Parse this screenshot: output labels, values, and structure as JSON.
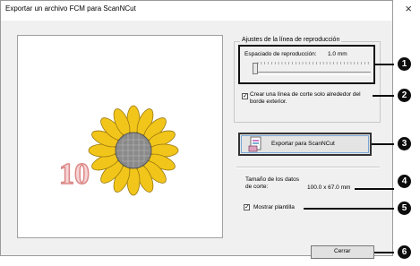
{
  "window": {
    "title": "Exportar un archivo FCM para ScanNCut",
    "close_glyph": "×"
  },
  "preview": {
    "number_text": "10",
    "flower_color": "#f2c51a",
    "number_color": "#e4a0a0"
  },
  "playback": {
    "group_label": "Ajustes de la línea de reproducción",
    "spacing_label": "Espaciado de reproducción:",
    "spacing_value": "1.0 mm",
    "slider_level": 0.0
  },
  "cut_line": {
    "checked": true,
    "label": "Crear una línea de corte solo alrededor del borde exterior."
  },
  "export_button": {
    "label": "Exportar para ScanNCut"
  },
  "cut_data": {
    "label": "Tamaño de los datos de corte:",
    "value": "100.0 x 67.0 mm"
  },
  "show_template": {
    "checked": true,
    "label": "Mostrar plantilla"
  },
  "close_button": {
    "label": "Cerrar"
  },
  "markers": [
    "1",
    "2",
    "3",
    "4",
    "5",
    "6"
  ],
  "colors": {
    "marker": "#0d0d0d",
    "export_border": "#333333"
  }
}
